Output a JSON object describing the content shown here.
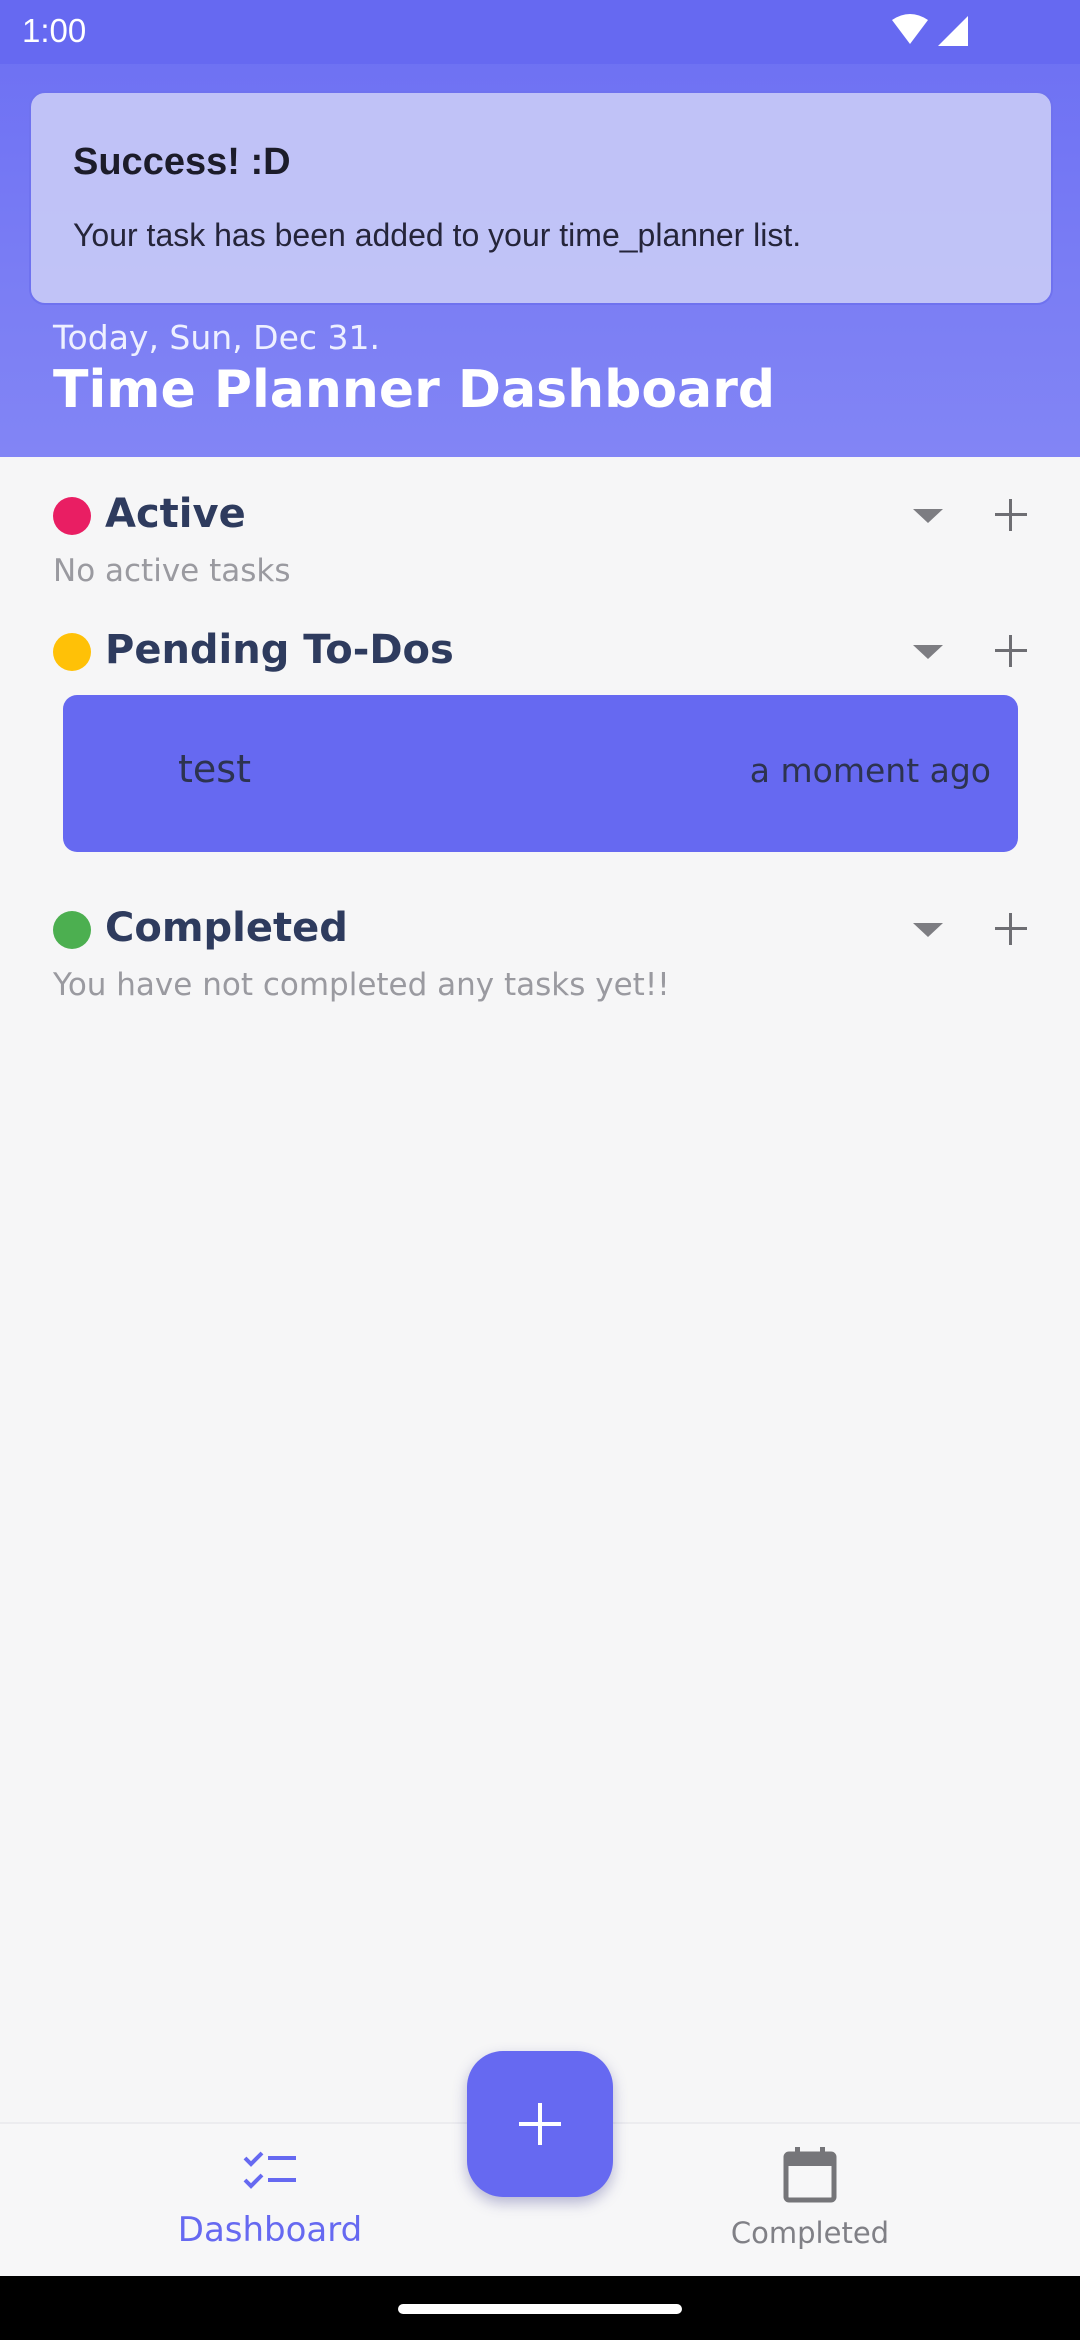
{
  "status_bar": {
    "time": "1:00"
  },
  "toast": {
    "title": "Success! :D",
    "message": "Your task has been added to your time_planner list."
  },
  "header": {
    "date": "Today, Sun, Dec 31.",
    "title": "Time Planner Dashboard"
  },
  "sections": {
    "active": {
      "title": "Active",
      "color": "#e91e63",
      "empty_text": "No active tasks"
    },
    "pending": {
      "title": "Pending To-Dos",
      "color": "#ffc107"
    },
    "completed": {
      "title": "Completed",
      "color": "#4caf50",
      "empty_text": "You have not completed any tasks yet!!"
    }
  },
  "tasks": [
    {
      "name": "test",
      "time": "a moment ago"
    }
  ],
  "nav": {
    "dashboard": {
      "label": "Dashboard",
      "icon": "checklist-icon"
    },
    "completed": {
      "label": "Completed",
      "icon": "calendar-icon"
    }
  },
  "colors": {
    "accent": "#6669f1"
  }
}
